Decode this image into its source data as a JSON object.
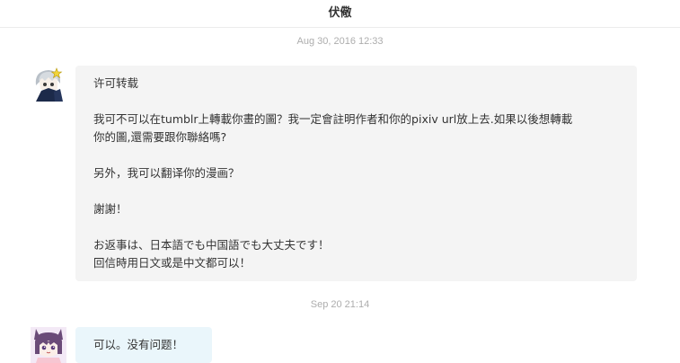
{
  "header": {
    "title": "伏儆"
  },
  "messages": [
    {
      "timestamp": "Aug 30, 2016 12:33",
      "lines": [
        "许可转载",
        "",
        "我可不可以在tumblr上轉載你畫的圖？我一定會註明作者和你的pixiv url放上去.如果以後想轉載",
        "你的圖,還需要跟你聯絡嗎?",
        "",
        "另外，我可以翻译你的漫画？",
        "",
        "謝謝！",
        "",
        "お返事は、日本語でも中国語でも大丈夫です！",
        "回信時用日文或是中文都可以！"
      ]
    },
    {
      "timestamp": "Sep 20 21:14",
      "lines": [
        "可以。没有问题！"
      ]
    }
  ],
  "colors": {
    "incoming_bubble": "#f4f4f4",
    "outgoing_bubble": "#eaf6fb",
    "timestamp": "#adadad"
  }
}
